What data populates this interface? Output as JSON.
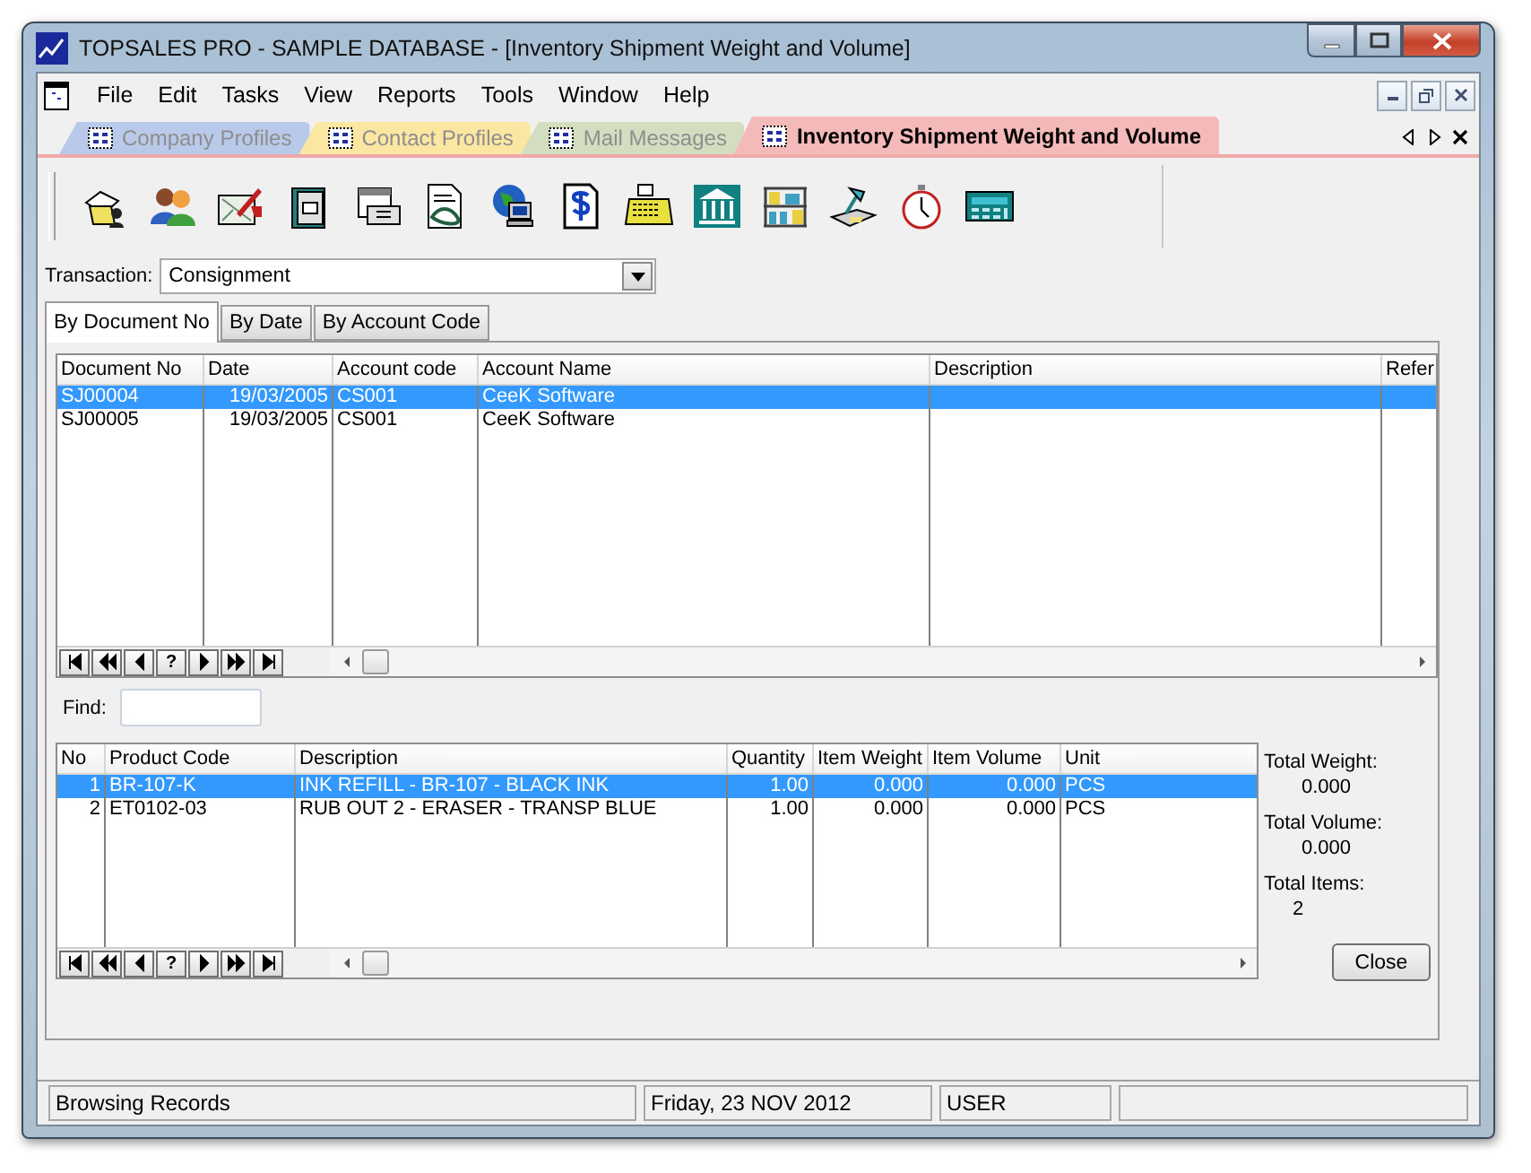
{
  "window": {
    "title": "TOPSALES PRO - SAMPLE DATABASE - [Inventory Shipment Weight and Volume]"
  },
  "menu": [
    "File",
    "Edit",
    "Tasks",
    "View",
    "Reports",
    "Tools",
    "Window",
    "Help"
  ],
  "document_tabs": [
    {
      "label": "Company Profiles",
      "selected": false,
      "color": "#b9c9e9"
    },
    {
      "label": "Contact Profiles",
      "selected": false,
      "color": "#fbe6a2"
    },
    {
      "label": "Mail Messages",
      "selected": false,
      "color": "#d3deC1"
    },
    {
      "label": "Inventory Shipment Weight and Volume",
      "selected": true,
      "color": "#f4b9b9"
    }
  ],
  "transaction": {
    "label": "Transaction:",
    "value": "Consignment"
  },
  "view_tabs": [
    {
      "label": "By Document No",
      "selected": true
    },
    {
      "label": "By Date",
      "selected": false
    },
    {
      "label": "By Account Code",
      "selected": false
    }
  ],
  "documents": {
    "columns": [
      "Document No",
      "Date",
      "Account code",
      "Account Name",
      "Description",
      "Refer"
    ],
    "rows": [
      {
        "cells": [
          "SJ00004",
          "19/03/2005",
          "CS001",
          "CeeK Software"
        ],
        "selected": true
      },
      {
        "cells": [
          "SJ00005",
          "19/03/2005",
          "CS001",
          "CeeK Software"
        ],
        "selected": false
      }
    ],
    "navigator_help": "?"
  },
  "find": {
    "label": "Find:"
  },
  "items": {
    "columns": [
      "No",
      "Product Code",
      "Description",
      "Quantity",
      "Item Weight",
      "Item Volume",
      "Unit"
    ],
    "rows": [
      {
        "cells": [
          "1",
          "BR-107-K",
          "INK REFILL - BR-107 - BLACK INK",
          "1.00",
          "0.000",
          "0.000",
          "PCS"
        ],
        "selected": true
      },
      {
        "cells": [
          "2",
          "ET0102-03",
          "RUB OUT 2 - ERASER - TRANSP BLUE",
          "1.00",
          "0.000",
          "0.000",
          "PCS"
        ],
        "selected": false
      }
    ],
    "navigator_help": "?"
  },
  "totals": [
    {
      "label": "Total Weight:",
      "value": "0.000"
    },
    {
      "label": "Total Volume:",
      "value": "0.000"
    },
    {
      "label": "Total Items:",
      "value": "2"
    }
  ],
  "close_button": "Close",
  "status_bar": [
    "Browsing Records",
    "Friday, 23 NOV 2012",
    "USER"
  ]
}
